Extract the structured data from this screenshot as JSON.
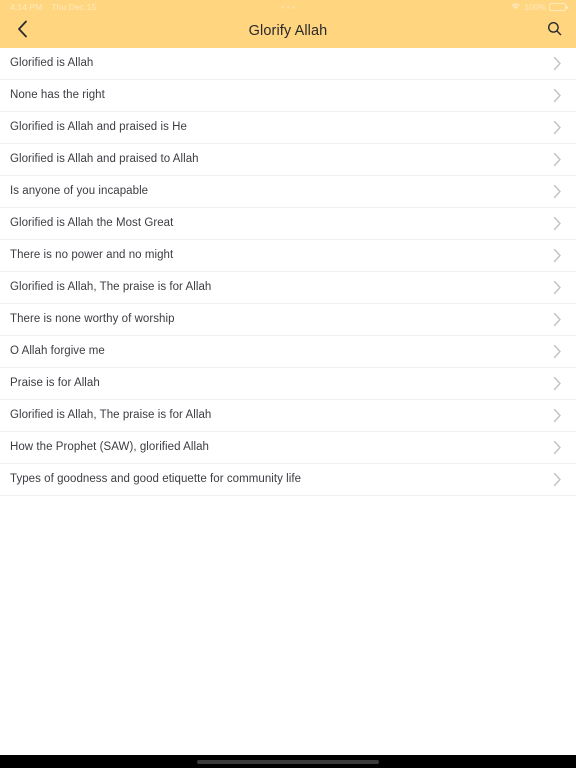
{
  "status_bar": {
    "time": "4:14 PM",
    "date": "Thu Dec 15",
    "wifi_icon": "wifi-icon",
    "battery_percent": "100%",
    "battery_icon": "battery-icon",
    "center_dots": "recording-dots-icon"
  },
  "nav_bar": {
    "back_icon": "chevron-left-icon",
    "title": "Glorify Allah",
    "search_icon": "search-icon",
    "background_color": "#ffd580",
    "title_color": "#2a2a2a"
  },
  "list": {
    "chevron_icon": "chevron-right-icon",
    "items": [
      {
        "label": "Glorified is Allah"
      },
      {
        "label": "None has the right"
      },
      {
        "label": "Glorified is Allah and praised is He"
      },
      {
        "label": "Glorified is Allah and praised to Allah"
      },
      {
        "label": "Is anyone of you incapable"
      },
      {
        "label": "Glorified is Allah the Most Great"
      },
      {
        "label": "There is no power and no might"
      },
      {
        "label": "Glorified is Allah, The praise is for Allah"
      },
      {
        "label": "There is none worthy of worship"
      },
      {
        "label": "O Allah forgive me"
      },
      {
        "label": "Praise is for Allah"
      },
      {
        "label": "Glorified is Allah, The praise is for Allah"
      },
      {
        "label": "How the Prophet (SAW), glorified Allah"
      },
      {
        "label": "Types of goodness and good etiquette for community life"
      }
    ]
  },
  "home_bar": {
    "indicator": "home-indicator"
  }
}
